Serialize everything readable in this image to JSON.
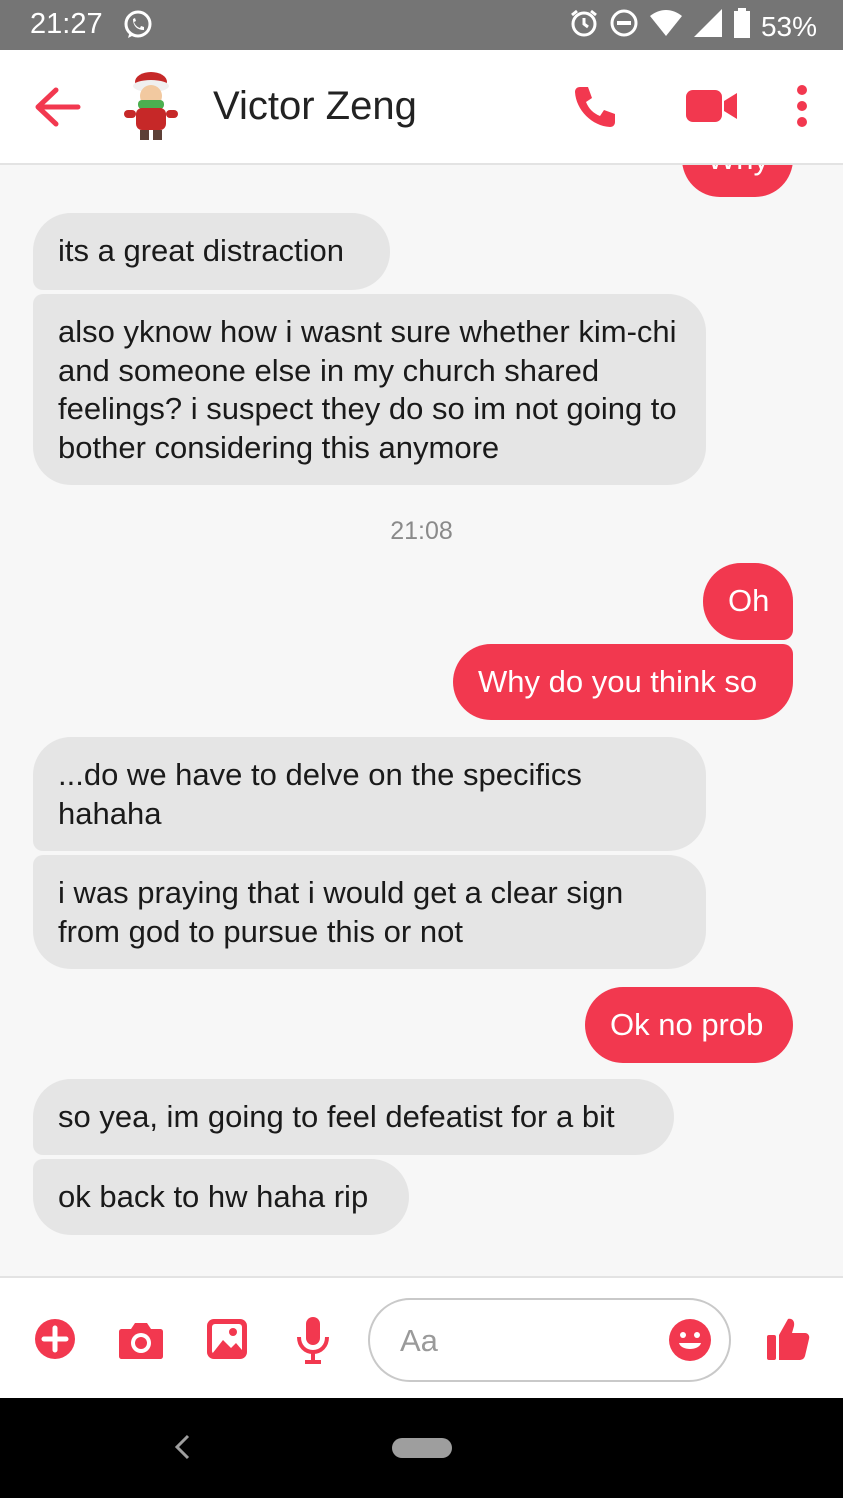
{
  "status_bar": {
    "time": "21:27",
    "battery": "53%",
    "icons": [
      "whatsapp-icon",
      "alarm-icon",
      "do-not-disturb-icon",
      "wifi-icon",
      "signal-icon",
      "battery-icon"
    ]
  },
  "header": {
    "contact_name": "Victor Zeng",
    "icons": [
      "back-arrow-icon",
      "phone-icon",
      "video-camera-icon",
      "more-vertical-icon"
    ]
  },
  "messages": [
    {
      "sender": "me",
      "text": "Why"
    },
    {
      "sender": "them",
      "text": "its a great distraction"
    },
    {
      "sender": "them",
      "text": "also yknow how i wasnt sure whether kim-chi and someone else in my church shared feelings? i suspect they do so im not going to bother considering this anymore"
    },
    {
      "sender": "me",
      "text": "Oh"
    },
    {
      "sender": "me",
      "text": "Why do you think so"
    },
    {
      "sender": "them",
      "text": "...do we have to delve on the specifics hahaha"
    },
    {
      "sender": "them",
      "text": "i was praying that i would get a clear sign from god to pursue this or not"
    },
    {
      "sender": "me",
      "text": "Ok no prob"
    },
    {
      "sender": "them",
      "text": "so yea, im going to feel defeatist for a bit"
    },
    {
      "sender": "them",
      "text": "ok back to hw haha rip"
    }
  ],
  "timestamp": "21:08",
  "composer": {
    "placeholder": "Aa",
    "icons": [
      "plus-circle-icon",
      "camera-icon",
      "image-icon",
      "microphone-icon",
      "emoji-icon",
      "thumbs-up-icon"
    ]
  },
  "colors": {
    "accent": "#f2384f",
    "incoming_bubble": "#e5e5e5",
    "status_bar": "#757575"
  }
}
